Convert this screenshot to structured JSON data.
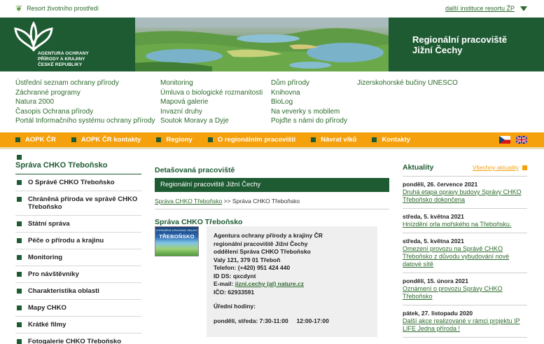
{
  "topbar": {
    "ministry": "Resort životního prostředí",
    "other_institutions": "další instituce resortu ŽP"
  },
  "header": {
    "logo_lines": [
      "AGENTURA OCHRANY",
      "PŘÍRODY A KRAJINY",
      "ČESKÉ REPUBLIKY"
    ],
    "region_title_1": "Regionální pracoviště",
    "region_title_2": "Jižní Čechy"
  },
  "links": {
    "col1": [
      "Ústřední seznam ochrany přírody",
      "Záchranné programy",
      "Natura 2000",
      "Časopis Ochrana přírody",
      "Portál Informačního systému ochrany přírody"
    ],
    "col2": [
      "Monitoring",
      "Úmluva o biologické rozmanitosti",
      "Mapová galerie",
      "Invazní druhy",
      "Soutok Moravy a Dyje"
    ],
    "col3": [
      "Dům přírody",
      "Knihovna",
      "BioLog",
      "Na veverky s mobilem",
      "Pojďte s námi do přírody"
    ],
    "col4": [
      "Jizerskohorské bučiny UNESCO"
    ]
  },
  "nav": {
    "items": [
      "AOPK ČR",
      "AOPK ČR kontakty",
      "Regiony",
      "O regionálním pracovišti",
      "Návrat vlků",
      "Kontakty"
    ]
  },
  "sidebar": {
    "title": "Správa CHKO Třeboňsko",
    "items": [
      "O Správě CHKO Třeboňsko",
      "Chráněná příroda ve správě CHKO Třeboňsko",
      "Státní správa",
      "Péče o přírodu a krajinu",
      "Monitoring",
      "Pro návštěvníky",
      "Charakteristika oblasti",
      "Mapy CHKO",
      "Krátké filmy",
      "Fotogalerie CHKO Třeboňsko"
    ]
  },
  "main": {
    "detail_heading": "Detašovaná pracoviště",
    "green_bar": "Regionální pracoviště Jižní Čechy",
    "crumb_link": "Správa CHKO Třeboňsko",
    "crumb_sep": ">>",
    "crumb_current": "Správa CHKO Třeboňsko",
    "section_title": "Správa CHKO Třeboňsko",
    "thumb_text": "TŘEBOŇSKO",
    "thumb_small": "CHRÁNĚNÁ KRAJINNÁ OBLAST",
    "card": {
      "line1": "Agentura ochrany přírody a krajiny ČR",
      "line2": "regionální pracoviště Jižní Čechy",
      "line3": "oddělení Správa CHKO Třeboňsko",
      "line4": "Valy 121, 379 01 Třeboň",
      "line5": "Telefon: (+420) 951 424 440",
      "line6": "ID DS: qxcdynt",
      "email_label": "E-mail:",
      "email": "jizni.cechy (at) nature.cz",
      "line8": "IČO: 62933591",
      "hours_label": "Úřední hodiny:",
      "hours": "pondělí, středa: 7:30-11:00     12:00-17:00"
    }
  },
  "news": {
    "title": "Aktuality",
    "all": "Všechny aktuality",
    "items": [
      {
        "date": "pondělí, 26. července 2021",
        "text": "Druhá etapa opravy budovy Správy CHKO Třeboňsko dokončena"
      },
      {
        "date": "středa, 5. května 2021",
        "text": "Hnízdění orla mořského na Třeboňsku."
      },
      {
        "date": "středa, 5. května 2021",
        "text": "Omezení provozu na Správě CHKO Třeboňsko z důvodu vybudování nové datové sítě"
      },
      {
        "date": "pondělí, 15. února 2021",
        "text": "Oznámení o provozu Správy CHKO Třeboňsko"
      },
      {
        "date": "pátek, 27. listopadu 2020",
        "text": "Další akce realizované v rámci projektu IP LIFE Jedna příroda !"
      }
    ]
  },
  "colors": {
    "brand_green": "#1e5b33",
    "nav_orange": "#f5a00d",
    "link_green": "#2d6a2d"
  }
}
